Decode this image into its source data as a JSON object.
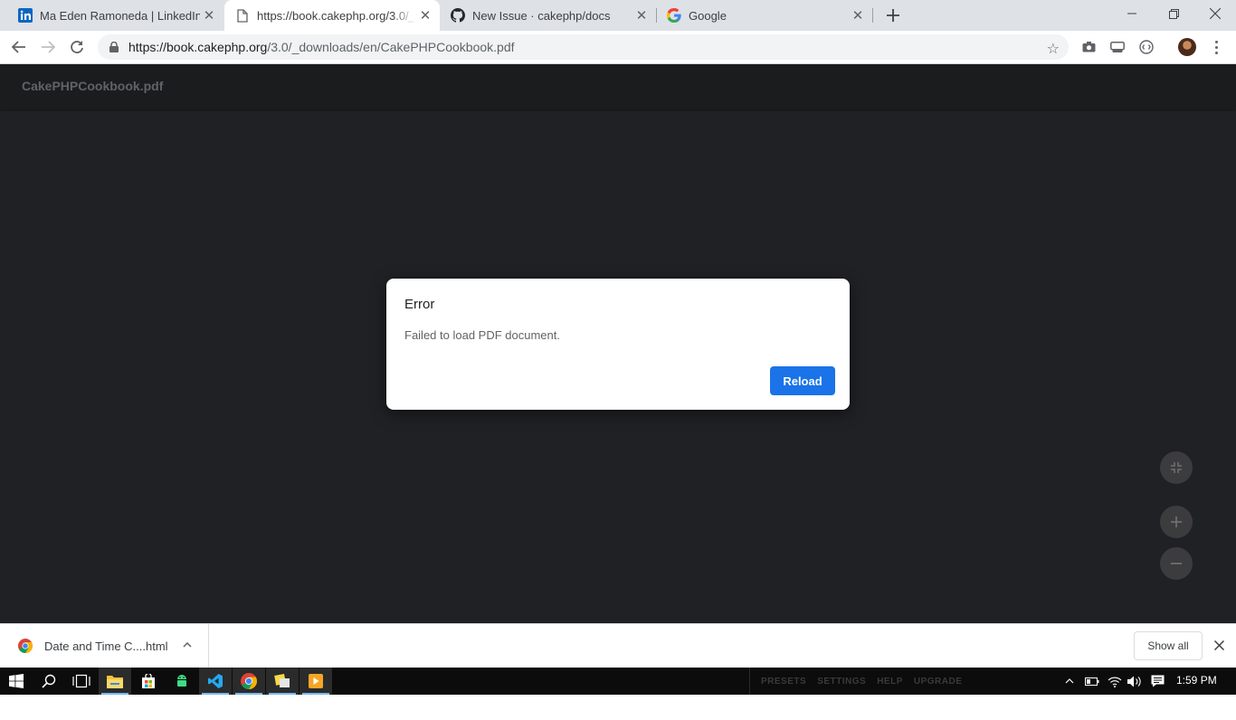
{
  "browser": {
    "tabs": [
      {
        "title": "Ma Eden Ramoneda | LinkedIn",
        "icon": "linkedin-icon",
        "active": false
      },
      {
        "title": "https://book.cakephp.org/3.0/_downloads/en/CakePHPCookbook.pdf",
        "icon": "document-icon",
        "active": true
      },
      {
        "title": "New Issue · cakephp/docs",
        "icon": "github-icon",
        "active": false
      },
      {
        "title": "Google",
        "icon": "google-icon",
        "active": false
      }
    ],
    "url_host": "https://book.cakephp.org",
    "url_path": "/3.0/_downloads/en/CakePHPCookbook.pdf"
  },
  "viewer": {
    "filename": "CakePHPCookbook.pdf"
  },
  "dialog": {
    "title": "Error",
    "message": "Failed to load PDF document.",
    "button": "Reload"
  },
  "downloads": {
    "item_name": "Date and Time C....html",
    "show_all": "Show all"
  },
  "taskbar": {
    "menu": [
      "PRESETS",
      "SETTINGS",
      "HELP",
      "UPGRADE"
    ],
    "time": "1:59 PM"
  },
  "colors": {
    "viewer_bg": "#202124",
    "accent": "#1a73e8",
    "tabstrip": "#dee1e6"
  }
}
